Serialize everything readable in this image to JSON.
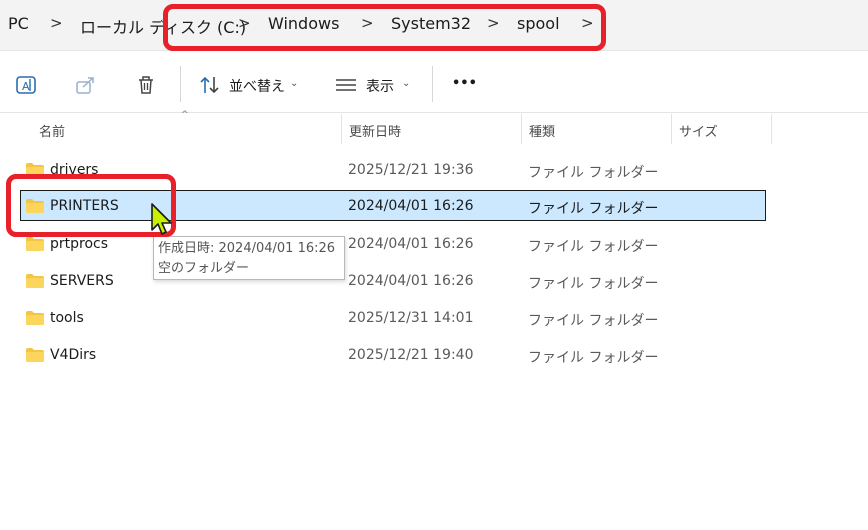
{
  "breadcrumb": {
    "items": [
      "PC",
      "ローカル ディスク (C:)",
      "Windows",
      "System32",
      "spool"
    ],
    "separator": ">"
  },
  "toolbar": {
    "rename_icon": "rename-icon",
    "share_icon": "share-icon",
    "delete_icon": "trash-icon",
    "sort_label": "並べ替え",
    "view_label": "表示",
    "more_label": "•••"
  },
  "columns": {
    "name": "名前",
    "date": "更新日時",
    "type": "種類",
    "size": "サイズ"
  },
  "files": [
    {
      "name": "drivers",
      "date": "2025/12/21 19:36",
      "type": "ファイル フォルダー"
    },
    {
      "name": "PRINTERS",
      "date": "2024/04/01 16:26",
      "type": "ファイル フォルダー"
    },
    {
      "name": "prtprocs",
      "date": "2024/04/01 16:26",
      "type": "ファイル フォルダー"
    },
    {
      "name": "SERVERS",
      "date": "2024/04/01 16:26",
      "type": "ファイル フォルダー"
    },
    {
      "name": "tools",
      "date": "2025/12/31 14:01",
      "type": "ファイル フォルダー"
    },
    {
      "name": "V4Dirs",
      "date": "2025/12/21 19:40",
      "type": "ファイル フォルダー"
    }
  ],
  "tooltip": {
    "line1": "作成日時: 2024/04/01 16:26",
    "line2": "空のフォルダー"
  },
  "colors": {
    "selection": "#cce8ff",
    "annotation": "#e8202a",
    "folder": "#f4c542",
    "cursor": "#c8f000"
  }
}
